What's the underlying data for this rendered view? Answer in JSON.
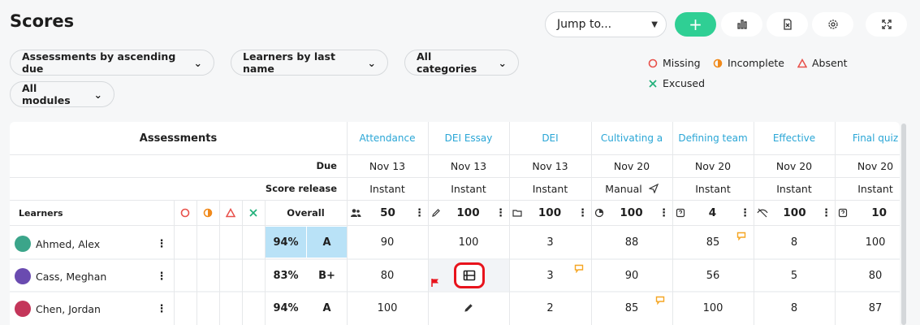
{
  "page": {
    "title": "Scores"
  },
  "toolbar": {
    "jump_label": "Jump to...",
    "add_label": "+"
  },
  "filters": [
    {
      "label": "Assessments by ascending due"
    },
    {
      "label": "Learners by last name"
    },
    {
      "label": "All categories"
    },
    {
      "label": "All modules"
    }
  ],
  "legend": {
    "missing": "Missing",
    "incomplete": "Incomplete",
    "absent": "Absent",
    "excused": "Excused"
  },
  "table": {
    "assessments_header": "Assessments",
    "due_label": "Due",
    "score_release_label": "Score release",
    "learners_label": "Learners",
    "overall_label": "Overall",
    "columns": [
      {
        "name": "Attendance",
        "due": "Nov 13",
        "release": "Instant",
        "points": "50"
      },
      {
        "name": "DEI Essay",
        "due": "Nov 13",
        "release": "Instant",
        "points": "100"
      },
      {
        "name": "DEI",
        "due": "Nov 13",
        "release": "Instant",
        "points": "100"
      },
      {
        "name": "Cultivating a",
        "due": "Nov 20",
        "release": "Manual",
        "points": "100"
      },
      {
        "name": "Defining team",
        "due": "Nov 20",
        "release": "Instant",
        "points": "4"
      },
      {
        "name": "Effective",
        "due": "Nov 20",
        "release": "Instant",
        "points": "100"
      },
      {
        "name": "Final quiz",
        "due": "Nov 20",
        "release": "Instant",
        "points": "10"
      }
    ],
    "rows": [
      {
        "name": "Ahmed, Alex",
        "percent": "94%",
        "grade": "A",
        "scores": [
          "90",
          "100",
          "3",
          "88",
          "85",
          "8",
          "100"
        ]
      },
      {
        "name": "Cass, Meghan",
        "percent": "83%",
        "grade": "B+",
        "scores": [
          "80",
          "",
          "3",
          "90",
          "56",
          "5",
          "80"
        ]
      },
      {
        "name": "Chen, Jordan",
        "percent": "94%",
        "grade": "A",
        "scores": [
          "100",
          "",
          "2",
          "85",
          "100",
          "8",
          "87"
        ]
      }
    ]
  },
  "colors": {
    "accent_green": "#2fcf94",
    "link_blue": "#2aa6d6",
    "missing_red": "#e8504a",
    "incomplete_orange": "#f08a1c",
    "excused_green": "#21b07a",
    "highlight_blue": "#b9e2f7",
    "comment_yellow": "#f5a623"
  }
}
